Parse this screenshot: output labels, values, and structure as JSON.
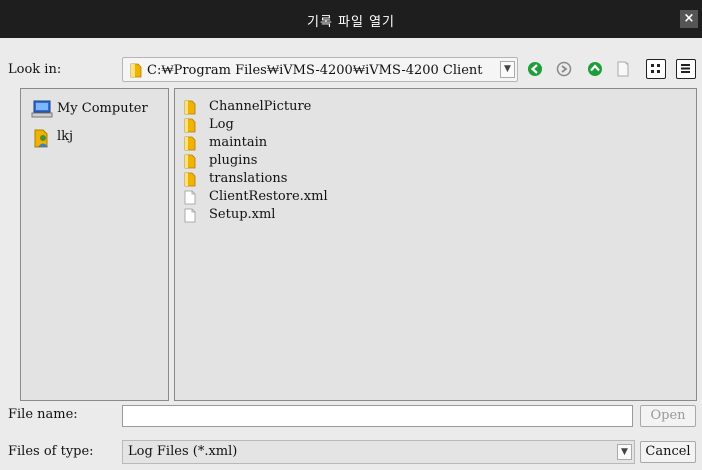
{
  "window": {
    "title": "기록 파일 열기",
    "close_label": "×"
  },
  "look_in": {
    "label": "Look in:",
    "path": "C:₩Program Files₩iVMS-4200₩iVMS-4200 Client"
  },
  "sidebar": {
    "items": [
      {
        "label": "My Computer",
        "icon": "computer-icon"
      },
      {
        "label": "lkj",
        "icon": "user-folder-icon"
      }
    ]
  },
  "files": [
    {
      "name": "ChannelPicture",
      "icon": "folder-icon"
    },
    {
      "name": "Log",
      "icon": "folder-icon"
    },
    {
      "name": "maintain",
      "icon": "folder-icon"
    },
    {
      "name": "plugins",
      "icon": "folder-icon"
    },
    {
      "name": "translations",
      "icon": "folder-icon"
    },
    {
      "name": "ClientRestore.xml",
      "icon": "file-icon"
    },
    {
      "name": "Setup.xml",
      "icon": "file-icon"
    }
  ],
  "file_name": {
    "label": "File name:",
    "value": ""
  },
  "file_type": {
    "label": "Files of type:",
    "value": "Log Files (*.xml)"
  },
  "buttons": {
    "open": "Open",
    "cancel": "Cancel"
  },
  "colors": {
    "titlebar": "#1e1e1e",
    "nav_green": "#1f9d3a",
    "folder": "#f0b400"
  }
}
